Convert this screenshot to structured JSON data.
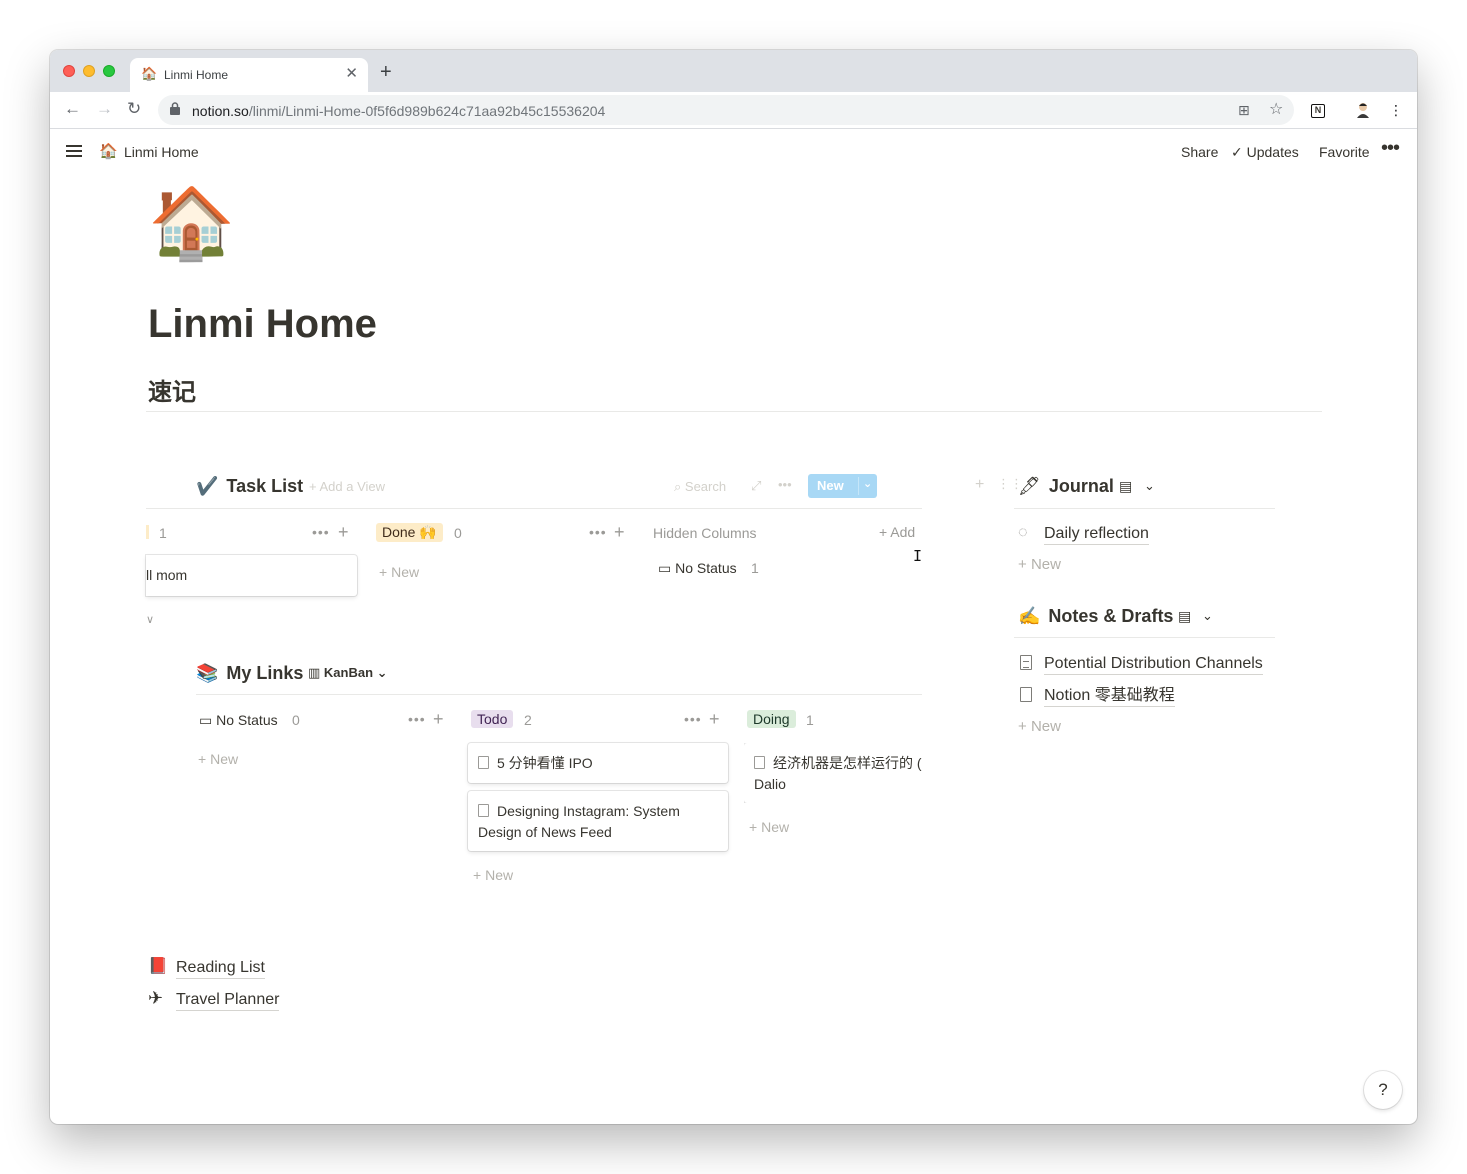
{
  "browser": {
    "tab_title": "Linmi Home",
    "tab_favicon": "🏠",
    "url_host": "notion.so",
    "url_path": "/linmi/Linmi-Home-0f5f6d989b624c71aa92b45c15536204",
    "extension_label": "N"
  },
  "topbar": {
    "breadcrumb_icon": "🏠",
    "breadcrumb": "Linmi Home",
    "share": "Share",
    "updates": "Updates",
    "favorite": "Favorite"
  },
  "page": {
    "icon": "🏠",
    "title": "Linmi Home",
    "subtitle": "速记"
  },
  "task_list": {
    "icon": "✔️",
    "title": "Task List",
    "add_view": "Add a View",
    "search": "Search",
    "new": "New",
    "columns": [
      {
        "label": "",
        "count": "1",
        "cards": [
          "ll mom"
        ]
      },
      {
        "label": "Done 🙌",
        "count": "0",
        "add": "New"
      }
    ],
    "hidden_columns": "Hidden Columns",
    "add_group": "Add",
    "hidden": [
      {
        "label": "No Status",
        "count": "1"
      }
    ]
  },
  "journal": {
    "icon": "🖋",
    "title": "Journal",
    "items": [
      "Daily reflection"
    ],
    "add": "New"
  },
  "notes": {
    "icon": "✍️",
    "title": "Notes & Drafts",
    "items": [
      "Potential Distribution Channels",
      "Notion 零基础教程"
    ],
    "add": "New"
  },
  "my_links": {
    "icon": "📚",
    "title": "My Links",
    "view": "KanBan",
    "columns": [
      {
        "label": "No Status",
        "count": "0",
        "add": "New"
      },
      {
        "label": "Todo",
        "count": "2",
        "cards": [
          "5 分钟看懂 IPO",
          "Designing Instagram: System Design of News Feed"
        ],
        "add": "New"
      },
      {
        "label": "Doing",
        "count": "1",
        "cards": [
          "经济机器是怎样运行的 (钟) Ray Dalio"
        ],
        "add": "New"
      }
    ]
  },
  "bottom_links": [
    {
      "icon": "📕",
      "label": "Reading List"
    },
    {
      "icon": "✈",
      "label": "Travel Planner"
    }
  ],
  "help": "?",
  "colors": {
    "done_tag": "#fdecc8",
    "todo_tag": "#e8deee",
    "doing_tag": "#dbeddb",
    "new_button": "#a8d8f5",
    "text": "#37352f"
  }
}
